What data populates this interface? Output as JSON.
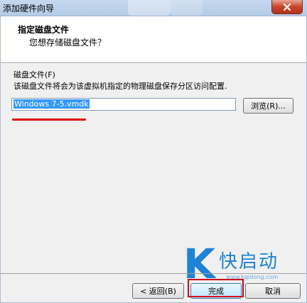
{
  "window": {
    "title": "添加硬件向导"
  },
  "header": {
    "title": "指定磁盘文件",
    "subtitle": "您想存储磁盘文件？"
  },
  "disk_file": {
    "label": "磁盘文件(F)",
    "description": "该磁盘文件将会为该虚拟机指定的物理磁盘保存分区访问配置.",
    "value": "Windows 7-5.vmdk",
    "browse_label": "浏览(R)..."
  },
  "footer": {
    "back_label": "< 返回(B)",
    "finish_label": "完成",
    "cancel_label": "取消"
  },
  "watermark": {
    "letter": "K",
    "name": "快启动",
    "url": "www.kqidong.com"
  },
  "colors": {
    "accent": "#1e82d6",
    "highlight_red": "#d0001a",
    "selection": "#3399ff"
  }
}
